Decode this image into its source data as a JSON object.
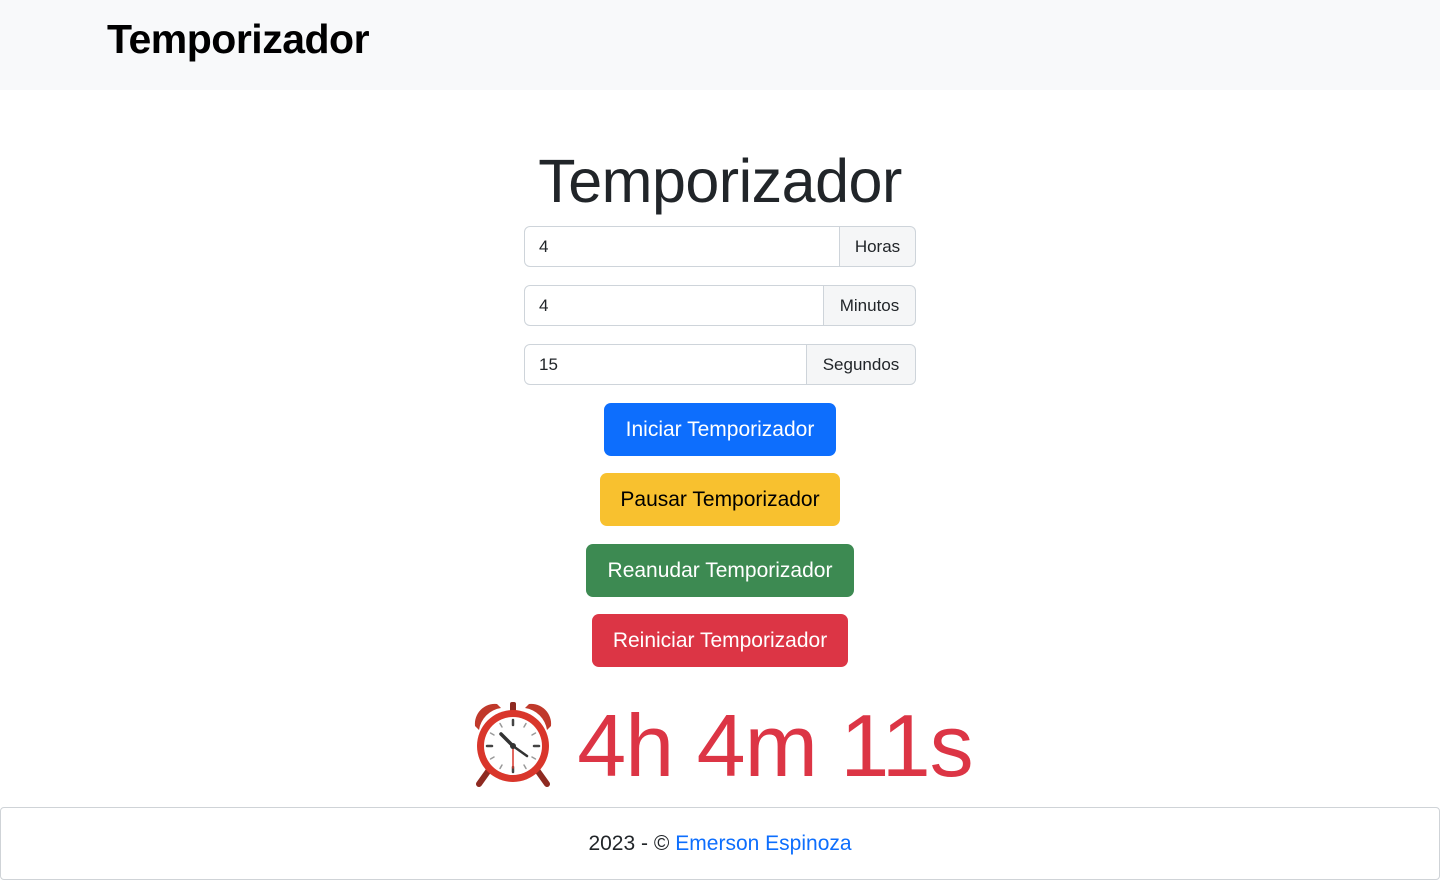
{
  "navbar": {
    "brand": "Temporizador"
  },
  "main": {
    "title": "Temporizador",
    "inputs": {
      "hours": {
        "value": "4",
        "label": "Horas"
      },
      "minutes": {
        "value": "4",
        "label": "Minutos"
      },
      "seconds": {
        "value": "15",
        "label": "Segundos"
      }
    },
    "buttons": {
      "start": "Iniciar Temporizador",
      "pause": "Pausar Temporizador",
      "resume": "Reanudar Temporizador",
      "reset": "Reiniciar Temporizador"
    },
    "countdown": {
      "icon": "alarm-clock-icon",
      "text": "4h 4m 11s"
    }
  },
  "footer": {
    "prefix": "2023 - ©",
    "author": "Emerson Espinoza"
  },
  "colors": {
    "primary": "#0d6efd",
    "warning": "#f8c12f",
    "success": "#3d8a52",
    "danger": "#dc3545",
    "navbar_bg": "#f8f9fa"
  }
}
